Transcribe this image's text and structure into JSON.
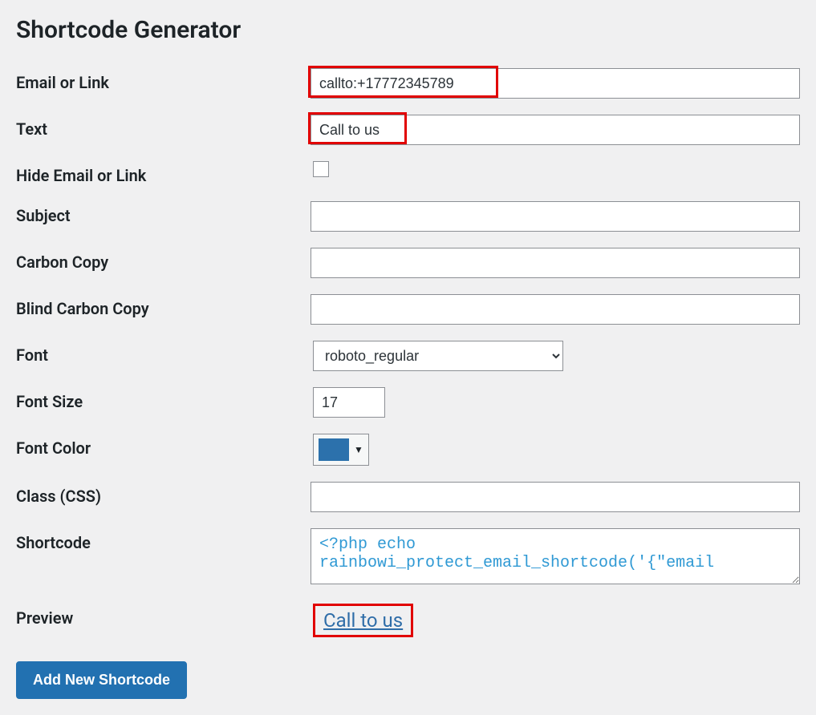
{
  "page": {
    "title": "Shortcode Generator"
  },
  "labels": {
    "email_or_link": "Email or Link",
    "text": "Text",
    "hide_email_or_link": "Hide Email or Link",
    "subject": "Subject",
    "carbon_copy": "Carbon Copy",
    "blind_carbon_copy": "Blind Carbon Copy",
    "font": "Font",
    "font_size": "Font Size",
    "font_color": "Font Color",
    "class_css": "Class (CSS)",
    "shortcode": "Shortcode",
    "preview": "Preview"
  },
  "values": {
    "email_or_link": "callto:+17772345789",
    "text": "Call to us",
    "hide_email_or_link": false,
    "subject": "",
    "carbon_copy": "",
    "blind_carbon_copy": "",
    "font": "roboto_regular",
    "font_size": "17",
    "font_color": "#2c71ac",
    "class_css": "",
    "shortcode": "<?php echo rainbowi_protect_email_shortcode('{\"email",
    "preview_text": "Call to us"
  },
  "buttons": {
    "add_new_shortcode": "Add New Shortcode"
  }
}
